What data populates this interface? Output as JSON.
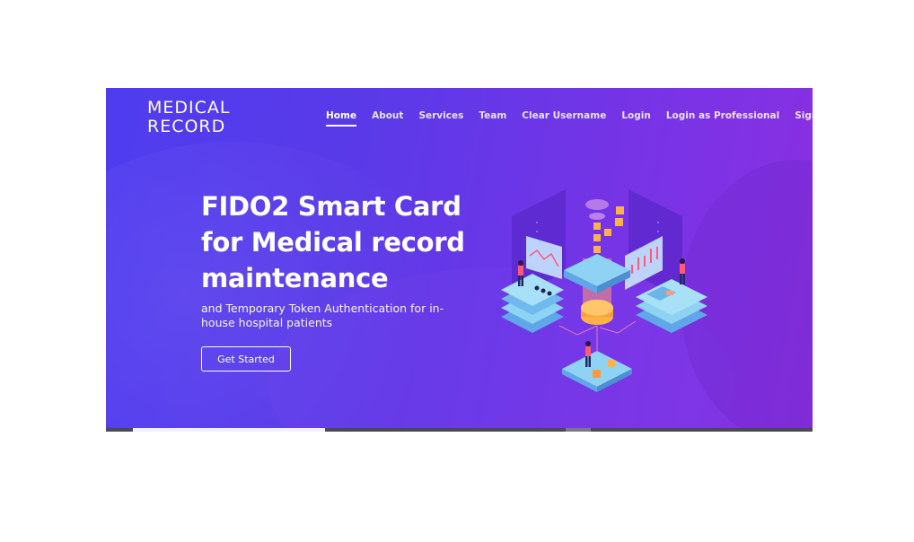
{
  "brand": {
    "line1": "MEDICAL",
    "line2": "RECORD"
  },
  "nav": {
    "items": [
      {
        "label": "Home"
      },
      {
        "label": "About"
      },
      {
        "label": "Services"
      },
      {
        "label": "Team"
      },
      {
        "label": "Clear Username"
      },
      {
        "label": "Login"
      },
      {
        "label": "Login as Professional"
      },
      {
        "label": "Sign Up"
      }
    ]
  },
  "hero": {
    "headline": "FIDO2 Smart Card for Medical record maintenance",
    "subtitle": "and Temporary Token Authentication for in-house hospital patients",
    "cta_label": "Get Started"
  },
  "colors": {
    "gradient_start": "#4f3cf0",
    "gradient_end": "#8a2fe0",
    "accent_orange": "#ffa23a",
    "platform_blue": "#8fd3f4"
  }
}
